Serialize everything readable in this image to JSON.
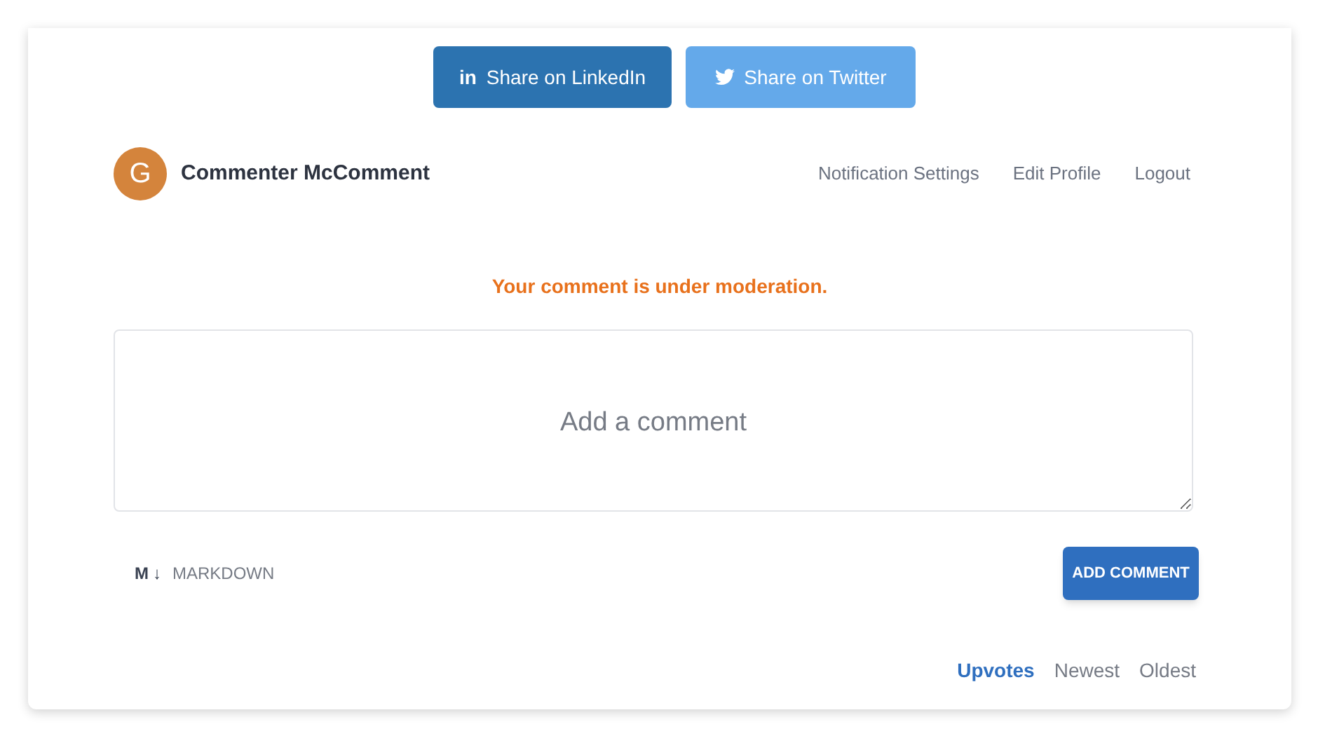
{
  "share_buttons": [
    {
      "kind": "linkedin",
      "icon": "in",
      "label": "Share on LinkedIn"
    },
    {
      "kind": "twitter",
      "label": "Share on Twitter"
    }
  ],
  "user": {
    "avatar_letter": "G",
    "name": "Commenter McComment"
  },
  "user_links": [
    "Notification Settings",
    "Edit Profile",
    "Logout"
  ],
  "moderation_notice": "Your comment is under moderation.",
  "comment_box": {
    "placeholder": "Add a comment"
  },
  "markdown": {
    "icon_letter": "M",
    "icon_arrow": "↓",
    "label": "MARKDOWN"
  },
  "submit_button": "ADD COMMENT",
  "sort_options": [
    {
      "label": "Upvotes",
      "selected": true
    },
    {
      "label": "Newest",
      "selected": false
    },
    {
      "label": "Oldest",
      "selected": false
    }
  ]
}
